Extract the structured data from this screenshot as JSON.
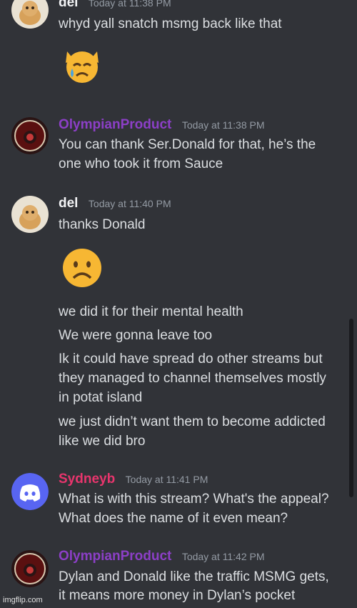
{
  "colors": {
    "background": "#313338",
    "text": "#dbdee1",
    "timestamp": "#949ba4",
    "author_purple": "#8c3fc7",
    "author_pink": "#e8356d",
    "author_white": "#f2f3f5",
    "discord_blurple": "#5865f2"
  },
  "messages": [
    {
      "author": "del",
      "timestamp": "Today at 11:38 PM",
      "avatar_icon": "cat-avatar-icon",
      "lines": [
        "whyd yall snatch msmg back like that"
      ],
      "emoji": "crying-cat-face-emoji"
    },
    {
      "author": "OlympianProduct",
      "timestamp": "Today at 11:38 PM",
      "avatar_icon": "olympian-logo-icon",
      "lines": [
        "You can thank Ser.Donald for that, he’s the",
        "one who took it from Sauce"
      ]
    },
    {
      "author": "del",
      "timestamp": "Today at 11:40 PM",
      "avatar_icon": "cat-avatar-icon",
      "lines": [
        "thanks Donald"
      ],
      "emoji": "frowning-face-emoji",
      "followups": [
        [
          "we did it for their mental health"
        ],
        [
          "We were gonna leave too"
        ],
        [
          "Ik it could have spread do other streams but",
          "they managed to channel themselves mostly",
          "in potat island"
        ],
        [
          "we just didn’t want them to become addicted",
          "like we did bro"
        ]
      ]
    },
    {
      "author": "Sydneyb",
      "timestamp": "Today at 11:41 PM",
      "avatar_icon": "discord-logo-icon",
      "lines": [
        "What is with this stream? What's the appeal?",
        "What does the name of it even mean?"
      ]
    },
    {
      "author": "OlympianProduct",
      "timestamp": "Today at 11:42 PM",
      "avatar_icon": "olympian-logo-icon",
      "lines": [
        "Dylan and Donald like the traffic MSMG gets,",
        "it means more money in Dylan’s pocket"
      ]
    }
  ],
  "watermark": "imgflip.com"
}
